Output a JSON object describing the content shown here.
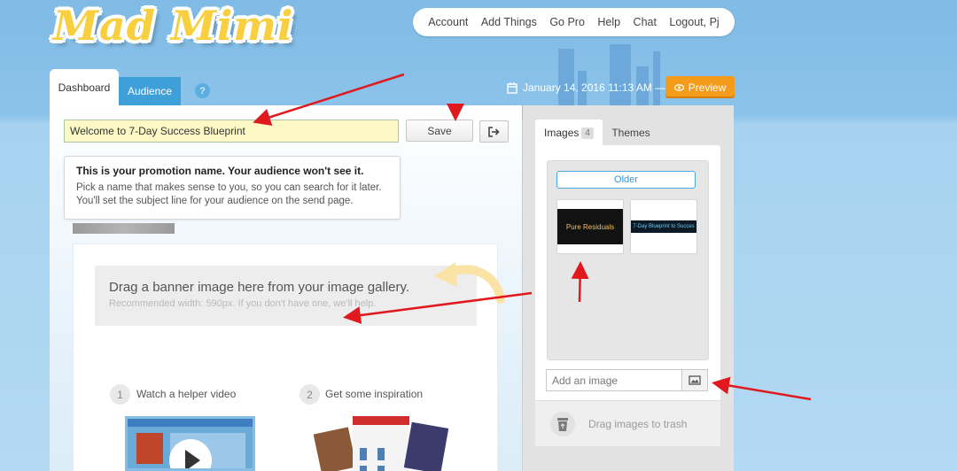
{
  "brand": {
    "logo_text": "Mad Mimi"
  },
  "topnav": {
    "items": [
      "Account",
      "Add Things",
      "Go Pro",
      "Help",
      "Chat",
      "Logout, Pj"
    ]
  },
  "tabs": {
    "dashboard": "Dashboard",
    "audience": "Audience",
    "help": "?"
  },
  "header": {
    "datetime": "January 14, 2016 11:13 AM —",
    "preview_label": "Preview"
  },
  "promotion": {
    "name_value": "Welcome to 7-Day Success Blueprint",
    "save_label": "Save",
    "tooltip_title": "This is your promotion name. Your audience won't see it.",
    "tooltip_line1": "Pick a name that makes sense to you, so you can search for it later.",
    "tooltip_line2": "You'll set the subject line for your audience on the send page."
  },
  "editor": {
    "banner_title": "Drag a banner image here from your image gallery.",
    "banner_sub": "Recommended width: 590px. If you don't have one, we'll help.",
    "step1_num": "1",
    "step1_label": "Watch a helper video",
    "step2_num": "2",
    "step2_label": "Get some inspiration"
  },
  "sidebar": {
    "images_tab": "Images",
    "images_count": "4",
    "themes_tab": "Themes",
    "older_label": "Older",
    "thumb1_text": "Pure Residuals",
    "thumb2_text": "7-Day Blueprint to Succes",
    "add_image_placeholder": "Add an image",
    "trash_label": "Drag images to trash"
  },
  "colors": {
    "accent_blue": "#3f9fd8",
    "preview_orange": "#f59b1c",
    "annotation_red": "#e0191f",
    "logo_yellow": "#f8cf3e"
  }
}
